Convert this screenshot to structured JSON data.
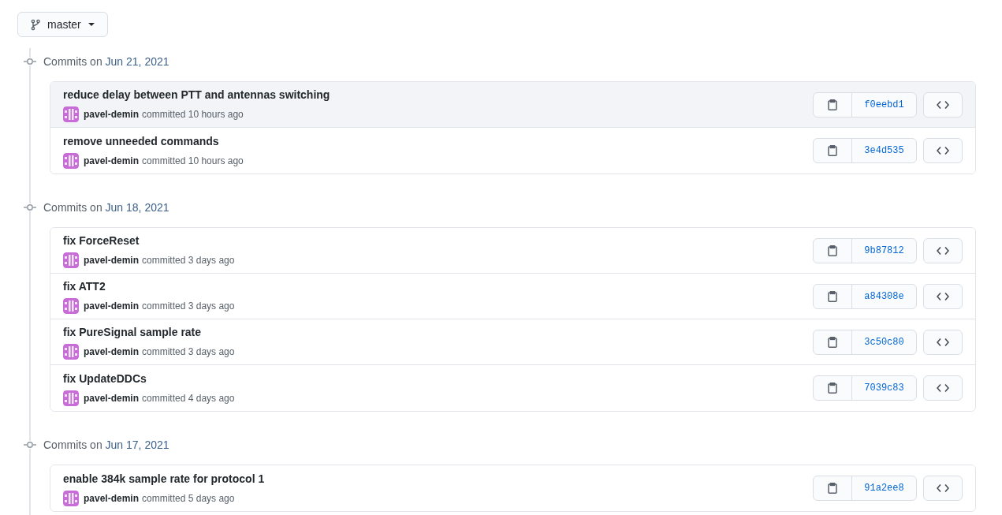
{
  "branch": {
    "label": "master"
  },
  "groups": [
    {
      "prefix": "Commits on",
      "date": "Jun 21, 2021",
      "commits": [
        {
          "message": "reduce delay between PTT and antennas switching",
          "author": "pavel-demin",
          "meta": "committed 10 hours ago",
          "sha": "f0eebd1",
          "highlighted": true
        },
        {
          "message": "remove unneeded commands",
          "author": "pavel-demin",
          "meta": "committed 10 hours ago",
          "sha": "3e4d535",
          "highlighted": false
        }
      ]
    },
    {
      "prefix": "Commits on",
      "date": "Jun 18, 2021",
      "commits": [
        {
          "message": "fix ForceReset",
          "author": "pavel-demin",
          "meta": "committed 3 days ago",
          "sha": "9b87812",
          "highlighted": false
        },
        {
          "message": "fix ATT2",
          "author": "pavel-demin",
          "meta": "committed 3 days ago",
          "sha": "a84308e",
          "highlighted": false
        },
        {
          "message": "fix PureSignal sample rate",
          "author": "pavel-demin",
          "meta": "committed 3 days ago",
          "sha": "3c50c80",
          "highlighted": false
        },
        {
          "message": "fix UpdateDDCs",
          "author": "pavel-demin",
          "meta": "committed 4 days ago",
          "sha": "7039c83",
          "highlighted": false
        }
      ]
    },
    {
      "prefix": "Commits on",
      "date": "Jun 17, 2021",
      "commits": [
        {
          "message": "enable 384k sample rate for protocol 1",
          "author": "pavel-demin",
          "meta": "committed 5 days ago",
          "sha": "91a2ee8",
          "highlighted": false
        }
      ]
    }
  ]
}
